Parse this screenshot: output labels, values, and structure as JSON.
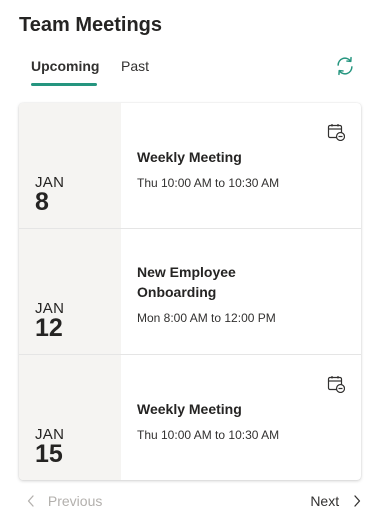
{
  "header": {
    "title": "Team Meetings"
  },
  "tabs": [
    {
      "label": "Upcoming",
      "active": true
    },
    {
      "label": "Past",
      "active": false
    }
  ],
  "refresh_icon": "refresh-icon",
  "accent_color": "#25957f",
  "meetings": [
    {
      "month": "JAN",
      "day": "8",
      "title_line1": "Weekly Meeting",
      "title_line2": "",
      "time": "Thu 10:00 AM to 10:30 AM",
      "icon": "calendar-cancel-icon"
    },
    {
      "month": "JAN",
      "day": "12",
      "title_line1": "New Employee",
      "title_line2": "Onboarding",
      "time": "Mon 8:00 AM to 12:00 PM",
      "icon": ""
    },
    {
      "month": "JAN",
      "day": "15",
      "title_line1": "Weekly Meeting",
      "title_line2": "",
      "time": "Thu 10:00 AM to 10:30 AM",
      "icon": "calendar-cancel-icon"
    }
  ],
  "pager": {
    "previous_label": "Previous",
    "next_label": "Next"
  }
}
